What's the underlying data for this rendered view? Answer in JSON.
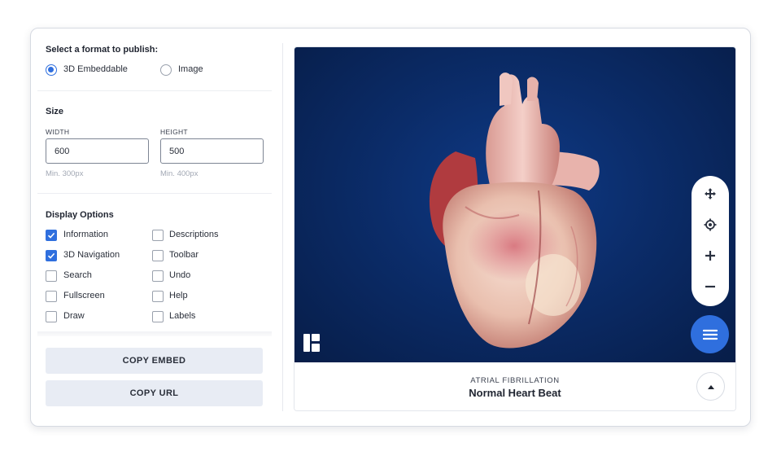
{
  "format": {
    "heading": "Select a format to publish:",
    "options": [
      {
        "label": "3D Embeddable",
        "selected": true
      },
      {
        "label": "Image",
        "selected": false
      }
    ]
  },
  "size": {
    "heading": "Size",
    "width_label": "WIDTH",
    "width_value": "600",
    "width_hint": "Min. 300px",
    "height_label": "HEIGHT",
    "height_value": "500",
    "height_hint": "Min. 400px"
  },
  "display": {
    "heading": "Display Options",
    "options": [
      {
        "label": "Information",
        "checked": true
      },
      {
        "label": "Descriptions",
        "checked": false
      },
      {
        "label": "3D Navigation",
        "checked": true
      },
      {
        "label": "Toolbar",
        "checked": false
      },
      {
        "label": "Search",
        "checked": false
      },
      {
        "label": "Undo",
        "checked": false
      },
      {
        "label": "Fullscreen",
        "checked": false
      },
      {
        "label": "Help",
        "checked": false
      },
      {
        "label": "Draw",
        "checked": false
      },
      {
        "label": "Labels",
        "checked": false
      }
    ]
  },
  "actions": {
    "copy_embed": "COPY EMBED",
    "copy_url": "COPY URL"
  },
  "viewer": {
    "subtitle": "ATRIAL FIBRILLATION",
    "title": "Normal Heart Beat",
    "controls": [
      "move-icon",
      "target-icon",
      "zoom-in-icon",
      "zoom-out-icon"
    ],
    "menu_icon": "hamburger-menu-icon",
    "accent": "#2f6fde",
    "background": "#0b2c69"
  }
}
